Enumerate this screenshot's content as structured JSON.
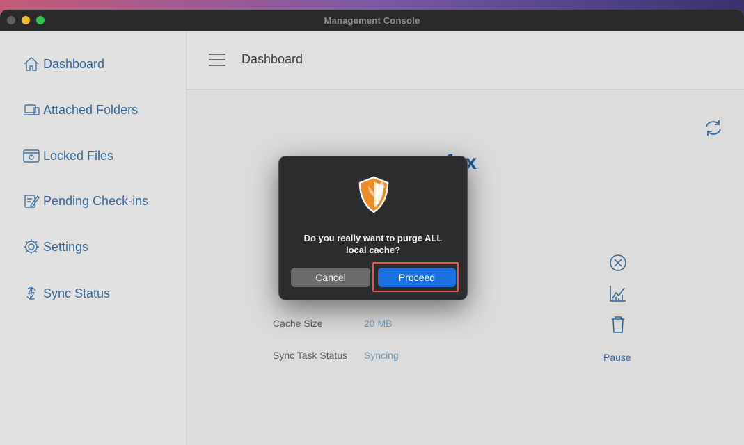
{
  "window": {
    "title": "Management Console"
  },
  "sidebar": {
    "items": [
      {
        "label": "Dashboard",
        "icon": "home-icon"
      },
      {
        "label": "Attached Folders",
        "icon": "folder-device-icon"
      },
      {
        "label": "Locked Files",
        "icon": "locked-files-icon"
      },
      {
        "label": "Pending Check-ins",
        "icon": "checkin-icon"
      },
      {
        "label": "Settings",
        "icon": "gear-icon"
      },
      {
        "label": "Sync Status",
        "icon": "sync-icon"
      }
    ]
  },
  "header": {
    "title": "Dashboard"
  },
  "main": {
    "brand_partial": "fox",
    "labels": [
      {
        "label": "Cache Size",
        "value": "20 MB"
      },
      {
        "label": "Sync Task Status",
        "value": "Syncing"
      }
    ],
    "pause_label": "Pause"
  },
  "dialog": {
    "message": "Do you really want to purge ALL local cache?",
    "cancel_label": "Cancel",
    "proceed_label": "Proceed"
  },
  "colors": {
    "accent": "#1a70e0",
    "link": "#3f6e9e",
    "brand": "#1f5f9c",
    "highlight": "#e8574f",
    "shield_orange": "#f08a24"
  }
}
